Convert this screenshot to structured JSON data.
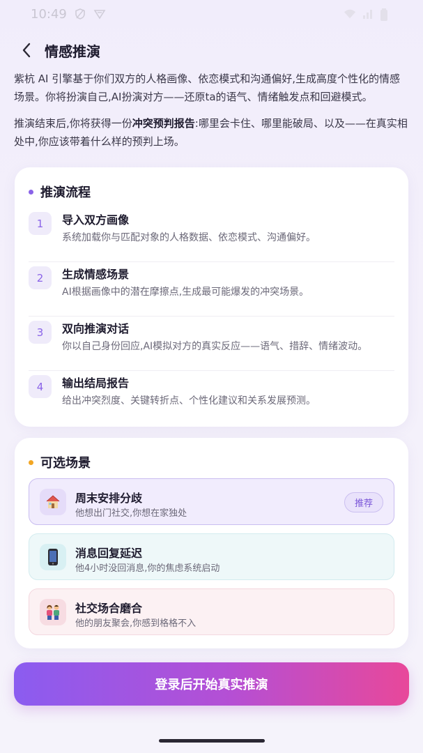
{
  "status_bar": {
    "time": "10:49"
  },
  "header": {
    "title": "情感推演"
  },
  "intro": {
    "paragraph_1": "紫杭 AI 引擎基于你们双方的人格画像、依恋模式和沟通偏好,生成高度个性化的情感场景。你将扮演自己,AI扮演对方——还原ta的语气、情绪触发点和回避模式。",
    "paragraph_2_prefix": "推演结束后,你将获得一份",
    "paragraph_2_bold": "冲突预判报告",
    "paragraph_2_suffix": ":哪里会卡住、哪里能破局、以及——在真实相处中,你应该带着什么样的预判上场。"
  },
  "flow": {
    "title": "推演流程",
    "steps": [
      {
        "num": "1",
        "title": "导入双方画像",
        "desc": "系统加载你与匹配对象的人格数据、依恋模式、沟通偏好。"
      },
      {
        "num": "2",
        "title": "生成情感场景",
        "desc": "AI根据画像中的潜在摩擦点,生成最可能爆发的冲突场景。"
      },
      {
        "num": "3",
        "title": "双向推演对话",
        "desc": "你以自己身份回应,AI模拟对方的真实反应——语气、措辞、情绪波动。"
      },
      {
        "num": "4",
        "title": "输出结局报告",
        "desc": "给出冲突烈度、关键转折点、个性化建议和关系发展预测。"
      }
    ]
  },
  "scenes": {
    "title": "可选场景",
    "items": [
      {
        "icon": "house-icon",
        "title": "周末安排分歧",
        "desc": "他想出门社交,你想在家独处",
        "badge": "推荐"
      },
      {
        "icon": "phone-icon",
        "title": "消息回复延迟",
        "desc": "他4小时没回消息,你的焦虑系统启动"
      },
      {
        "icon": "couple-icon",
        "title": "社交场合磨合",
        "desc": "他的朋友聚会,你感到格格不入"
      }
    ]
  },
  "cta": {
    "label": "登录后开始真实推演"
  },
  "colors": {
    "accent": "#8a63e8",
    "cta_start": "#8b5cf0",
    "cta_end": "#e8489a"
  }
}
